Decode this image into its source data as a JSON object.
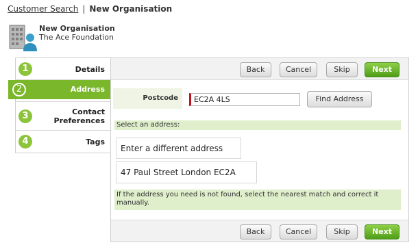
{
  "breadcrumb": {
    "link": "Customer Search",
    "separator": "|",
    "current": "New Organisation"
  },
  "org": {
    "title": "New Organisation",
    "subtitle": "The Ace Foundation",
    "icon": "organisation-icon"
  },
  "steps": [
    {
      "num": "1",
      "label": "Details"
    },
    {
      "num": "2",
      "label": "Address"
    },
    {
      "num": "3",
      "label": "Contact Preferences"
    },
    {
      "num": "4",
      "label": "Tags"
    }
  ],
  "active_step": 2,
  "toolbar": {
    "back": "Back",
    "cancel": "Cancel",
    "skip": "Skip",
    "next": "Next"
  },
  "postcode": {
    "label": "Postcode",
    "value": "EC2A 4LS",
    "find_button": "Find Address"
  },
  "select_address": {
    "hint": "Select an address:",
    "options": [
      "Enter a different address",
      "47 Paul Street London EC2A"
    ]
  },
  "note": "If the address you need is not found, select the nearest match and correct it manually.",
  "colors": {
    "accent_green": "#7ab72a",
    "hint_bg": "#dfeecb",
    "required_marker": "#c0141c"
  }
}
